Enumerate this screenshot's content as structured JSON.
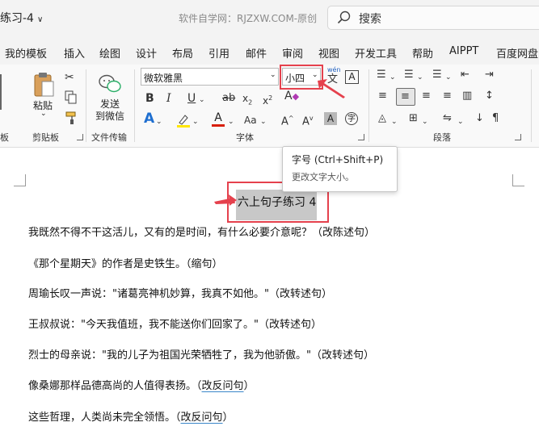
{
  "window": {
    "doc_title": "练习-4",
    "watermark": "软件自学网：RJZXW.COM-原创",
    "search_label": "搜索"
  },
  "tabs": [
    "我的模板",
    "插入",
    "绘图",
    "设计",
    "布局",
    "引用",
    "邮件",
    "审阅",
    "视图",
    "开发工具",
    "帮助",
    "AIPPT",
    "百度网盘"
  ],
  "ribbon": {
    "clipboard": {
      "paste": "粘贴",
      "group_label": "剪贴板"
    },
    "wechat": {
      "send_line1": "发送",
      "send_line2": "到微信",
      "group_label": "文件传输"
    },
    "font": {
      "font_name": "微软雅黑",
      "font_size": "小四",
      "wen": "wén",
      "group_label": "字体"
    },
    "paragraph": {
      "group_label": "段落"
    }
  },
  "tooltip": {
    "title": "字号 (Ctrl+Shift+P)",
    "desc": "更改文字大小。"
  },
  "document": {
    "heading": "六上句子练习 4",
    "lines": [
      {
        "text": "我既然不得不干这活儿，又有的是时间，有什么必要介意呢？（改陈述句）",
        "tail": ""
      },
      {
        "text": "《那个星期天》的作者是史铁生。（缩句）",
        "tail": ""
      },
      {
        "text": "周瑜长叹一声说：\"诸葛亮神机妙算，我真不如他。\"（改转述句）",
        "tail": ""
      },
      {
        "text": "王叔叔说：\"今天我值班，我不能送你们回家了。\"（改转述句）",
        "tail": ""
      },
      {
        "text": "烈士的母亲说：\"我的儿子为祖国光荣牺牲了，我为他骄傲。\"（改转述句）",
        "tail": ""
      },
      {
        "text": "像桑娜那样品德高尚的人值得表扬。（",
        "tail": "改反问句"
      },
      {
        "text": "这些哲理，人类尚未完全领悟。（",
        "tail": "改反问句"
      }
    ]
  },
  "colors": {
    "annotation_red": "#e5414d",
    "font_color_red": "#d81e06",
    "highlight_yellow": "#ffe600"
  }
}
